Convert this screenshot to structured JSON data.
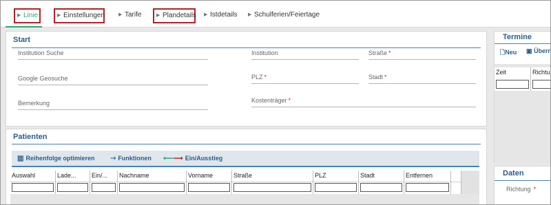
{
  "tabs": [
    {
      "label": "Linie",
      "active": true,
      "highlighted": true
    },
    {
      "label": "Einstellungen",
      "active": false,
      "highlighted": true
    },
    {
      "label": "Tarife",
      "active": false,
      "highlighted": false
    },
    {
      "label": "Plandetails",
      "active": false,
      "highlighted": true
    },
    {
      "label": "Istdetails",
      "active": false,
      "highlighted": false
    },
    {
      "label": "Schulferien/Feiertage",
      "active": false,
      "highlighted": false
    }
  ],
  "start": {
    "title": "Start",
    "fields": {
      "institution_suche": "Institution Suche",
      "institution": "Institution",
      "strasse": "Straße",
      "google_geosuche": "Google Geosuche",
      "plz": "PLZ",
      "stadt": "Stadt",
      "bemerkung": "Bemerkung",
      "kostentraeger": "Kostenträger"
    },
    "required_marker": "*"
  },
  "patienten": {
    "title": "Patienten",
    "toolbar": {
      "reihenfolge": "Reihenfolge optimieren",
      "funktionen": "Funktionen",
      "einausstieg": "Ein/Ausstieg"
    },
    "columns": [
      "Auswahl",
      "Lade...",
      "Ein/...",
      "Nachname",
      "Vorname",
      "Straße",
      "PLZ",
      "Stadt",
      "Entfernen"
    ]
  },
  "termine": {
    "title": "Termine",
    "neu": "Neu",
    "uebernehmen": "Überr",
    "columns": [
      "Zeit",
      "Richtu"
    ]
  },
  "daten": {
    "title": "Daten",
    "richtung": "Richtung"
  },
  "colors": {
    "accent_green": "#2aa876",
    "title_blue": "#2a5d8a",
    "highlight_red": "#b32025",
    "required_red": "#c0282d"
  }
}
